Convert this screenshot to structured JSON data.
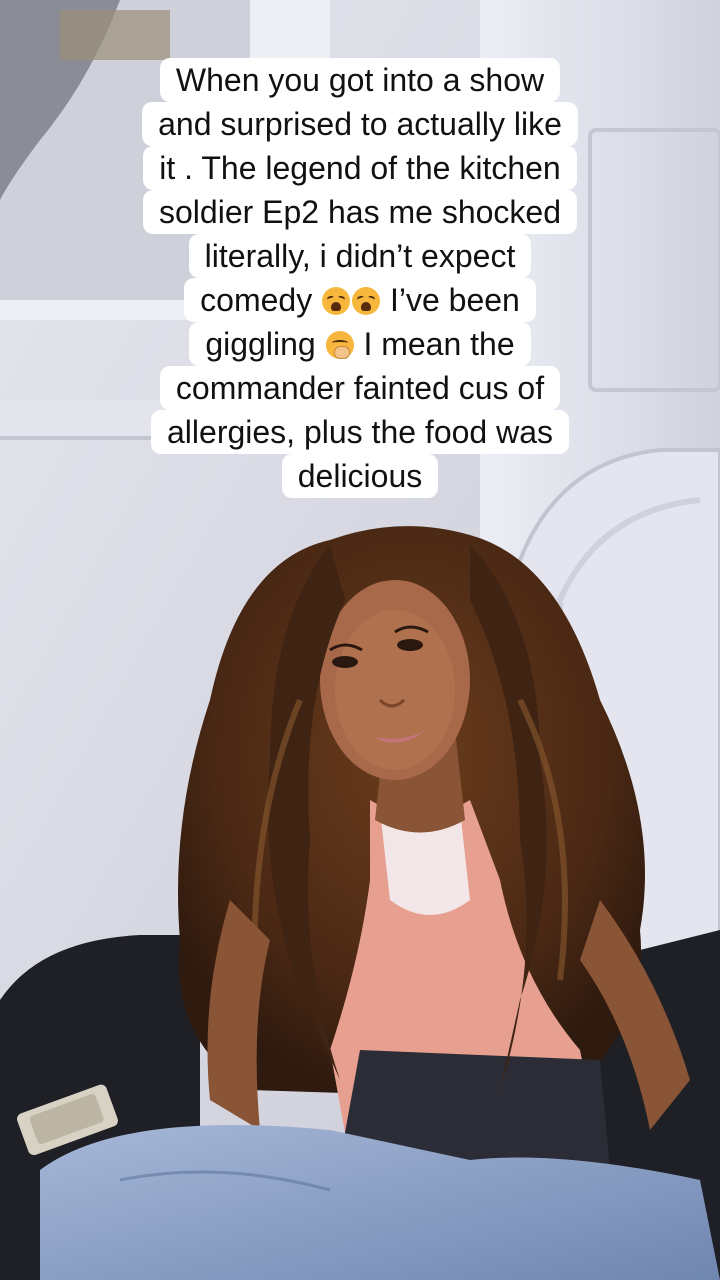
{
  "caption": {
    "lines": [
      [
        {
          "t": "When you got into a show"
        }
      ],
      [
        {
          "t": "and surprised to actually like"
        }
      ],
      [
        {
          "t": "it . The legend of the kitchen"
        }
      ],
      [
        {
          "t": "soldier Ep2 has me shocked"
        }
      ],
      [
        {
          "t": "literally, i didn’t expect"
        }
      ],
      [
        {
          "t": "comedy "
        },
        {
          "emoji": "weary-face-emoji"
        },
        {
          "emoji": "weary-face-emoji"
        },
        {
          "t": " I’ve been"
        }
      ],
      [
        {
          "t": "giggling "
        },
        {
          "emoji": "hand-over-mouth-emoji"
        },
        {
          "t": " I mean the"
        }
      ],
      [
        {
          "t": "commander fainted cus of"
        }
      ],
      [
        {
          "t": "allergies, plus the food was"
        }
      ],
      [
        {
          "t": "delicious"
        }
      ]
    ]
  },
  "colors": {
    "caption_bg": "#ffffff",
    "caption_text": "#111111",
    "wall": "#d9dae2",
    "hair": "#4a2a16",
    "jeans": "#8fa6cc"
  }
}
